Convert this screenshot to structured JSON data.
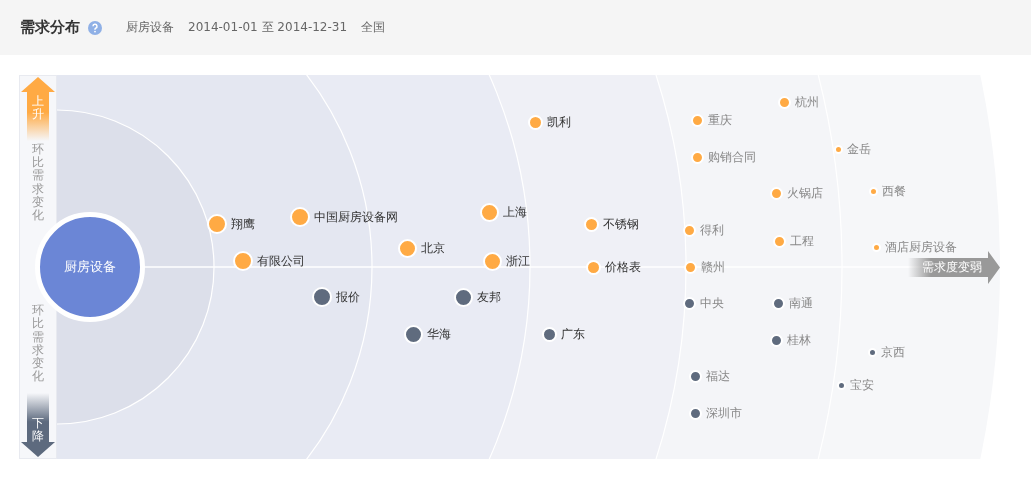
{
  "header": {
    "title": "需求分布",
    "keyword": "厨房设备",
    "date_range": "2014-01-01 至 2014-12-31",
    "region": "全国"
  },
  "axis": {
    "up_label": "上升",
    "up_caption": "环比需求变化",
    "down_caption": "环比需求变化",
    "down_label": "下降"
  },
  "hub": {
    "label": "厨房设备"
  },
  "direction_label": "需求度变弱",
  "nodes": [
    {
      "label": "翔鹰",
      "color": "#ffaa44"
    },
    {
      "label": "中国厨房设备网",
      "color": "#ffaa44"
    },
    {
      "label": "有限公司",
      "color": "#ffaa44"
    },
    {
      "label": "报价",
      "color": "#5f6b7e"
    },
    {
      "label": "北京",
      "color": "#ffaa44"
    },
    {
      "label": "上海",
      "color": "#ffaa44"
    },
    {
      "label": "浙江",
      "color": "#ffaa44"
    },
    {
      "label": "友邦",
      "color": "#5f6b7e"
    },
    {
      "label": "华海",
      "color": "#5f6b7e"
    },
    {
      "label": "凯利",
      "color": "#ffaa44"
    },
    {
      "label": "不锈钢",
      "color": "#ffaa44"
    },
    {
      "label": "价格表",
      "color": "#ffaa44"
    },
    {
      "label": "广东",
      "color": "#5f6b7e"
    },
    {
      "label": "重庆",
      "color": "#ffaa44"
    },
    {
      "label": "购销合同",
      "color": "#ffaa44"
    },
    {
      "label": "杭州",
      "color": "#ffaa44"
    },
    {
      "label": "火锅店",
      "color": "#ffaa44"
    },
    {
      "label": "得利",
      "color": "#ffaa44"
    },
    {
      "label": "工程",
      "color": "#ffaa44"
    },
    {
      "label": "赣州",
      "color": "#ffaa44"
    },
    {
      "label": "中央",
      "color": "#5f6b7e"
    },
    {
      "label": "南通",
      "color": "#5f6b7e"
    },
    {
      "label": "桂林",
      "color": "#5f6b7e"
    },
    {
      "label": "福达",
      "color": "#5f6b7e"
    },
    {
      "label": "深圳市",
      "color": "#5f6b7e"
    },
    {
      "label": "金岳",
      "color": "#ffaa44"
    },
    {
      "label": "西餐",
      "color": "#ffaa44"
    },
    {
      "label": "酒店厨房设备",
      "color": "#ffaa44"
    },
    {
      "label": "京西",
      "color": "#5f6b7e"
    },
    {
      "label": "宝安",
      "color": "#5f6b7e"
    }
  ]
}
